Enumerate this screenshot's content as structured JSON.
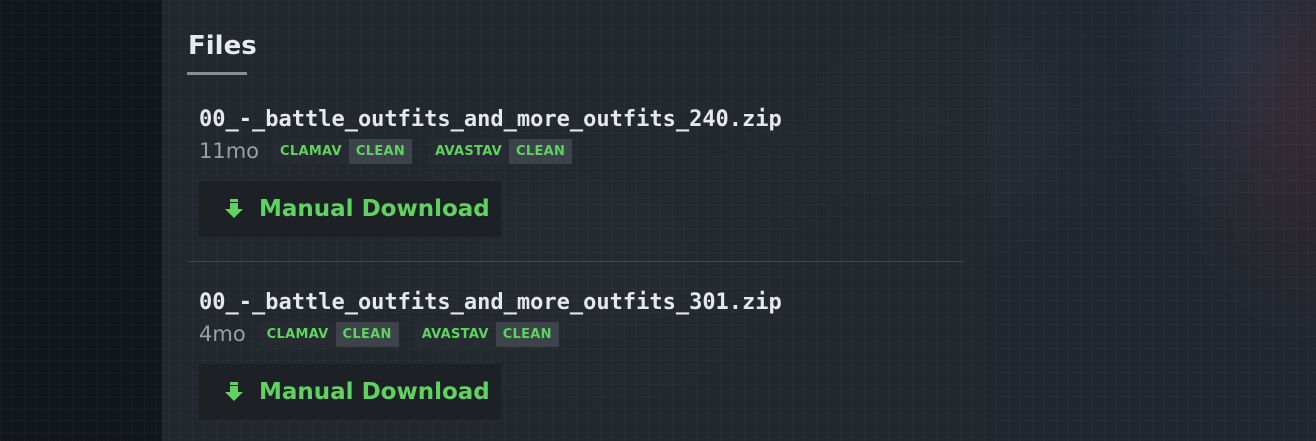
{
  "section": {
    "title": "Files"
  },
  "files": [
    {
      "name": "00_-_battle_outfits_and_more_outfits_240.zip",
      "age": "11mo",
      "scans": [
        {
          "engine": "CLAMAV",
          "result": "CLEAN"
        },
        {
          "engine": "AVASTAV",
          "result": "CLEAN"
        }
      ],
      "download_label": "Manual Download"
    },
    {
      "name": "00_-_battle_outfits_and_more_outfits_301.zip",
      "age": "4mo",
      "scans": [
        {
          "engine": "CLAMAV",
          "result": "CLEAN"
        },
        {
          "engine": "AVASTAV",
          "result": "CLEAN"
        }
      ],
      "download_label": "Manual Download"
    }
  ],
  "colors": {
    "accent_green": "#5fd35f",
    "background": "#1e232b"
  },
  "icons": {
    "download": "arrow-down-icon"
  }
}
